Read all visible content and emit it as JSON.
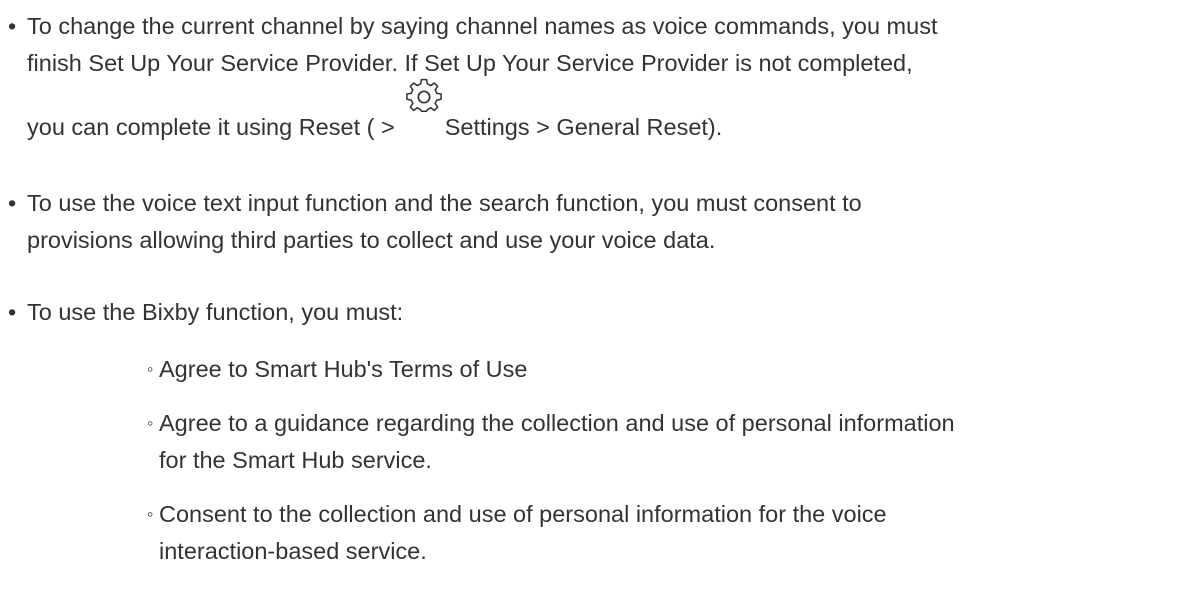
{
  "bullet_char": "•",
  "sub_bullet_char": "◦",
  "items": [
    {
      "lines": [
        "To change the current channel by saying channel names as voice commands, you must",
        "finish Set Up Your Service Provider. If Set Up Your Service Provider is not completed,"
      ],
      "icon_line_before": "you can complete it using Reset ( >",
      "icon": "settings-gear-icon",
      "icon_line_after": "Settings > General Reset)."
    },
    {
      "lines": [
        "To use the voice text input function and the search function, you must consent to",
        "provisions allowing third parties to collect and use your voice data."
      ]
    },
    {
      "lines": [
        "To use the Bixby function, you must:"
      ]
    }
  ],
  "sub_items": [
    {
      "lines": [
        "Agree to Smart Hub's Terms of Use"
      ]
    },
    {
      "lines": [
        "Agree to a guidance regarding the collection and use of personal information",
        "for the Smart Hub service."
      ]
    },
    {
      "lines": [
        "Consent to the collection and use of personal information for the voice",
        "interaction-based service."
      ]
    }
  ]
}
